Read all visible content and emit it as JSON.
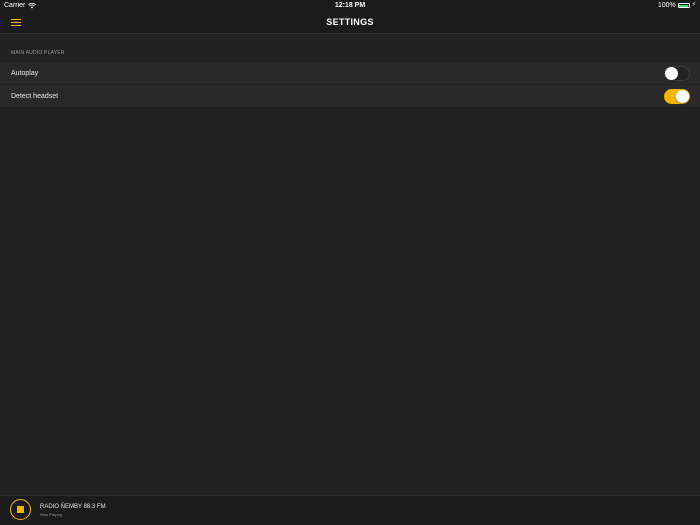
{
  "status_bar": {
    "carrier": "Carrier",
    "time": "12:18 PM",
    "battery": "100%"
  },
  "nav": {
    "title": "SETTINGS",
    "menu_icon": "hamburger-icon"
  },
  "section": {
    "header": "MAIN AUDIO PLAYER",
    "rows": [
      {
        "label": "Autoplay",
        "enabled": false
      },
      {
        "label": "Detect headset",
        "enabled": true
      }
    ]
  },
  "player": {
    "station": "RADIO ÑEMBY 88.3 FM",
    "status": "Now Playing"
  },
  "colors": {
    "accent": "#f2b705",
    "background": "#222222",
    "bar": "#1b1b1b",
    "row": "#292929"
  }
}
